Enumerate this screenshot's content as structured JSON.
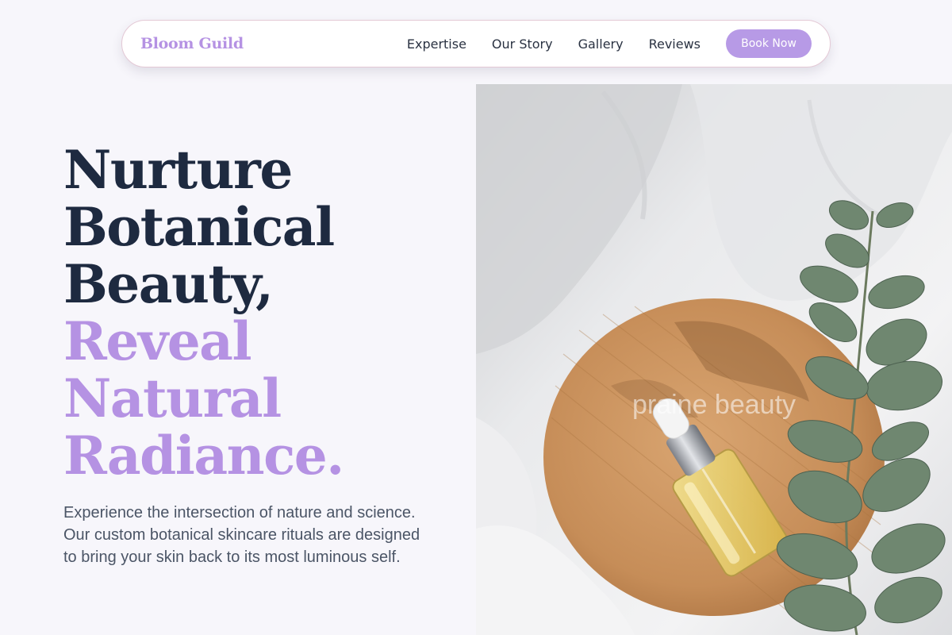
{
  "nav": {
    "brand": "Bloom Guild",
    "links": [
      "Expertise",
      "Our Story",
      "Gallery",
      "Reviews"
    ],
    "cta": "Book Now"
  },
  "hero": {
    "headline_dark": [
      "Nurture",
      "Botanical",
      "Beauty,"
    ],
    "headline_accent": [
      "Reveal",
      "Natural",
      "Radiance."
    ],
    "subtext": "Experience the intersection of nature and science. Our custom botanical skincare rituals are designed to bring your skin back to its most luminous self."
  },
  "photo": {
    "watermark": "praine beauty",
    "subject": "serum dropper bottle on wooden board with eucalyptus on white linen"
  },
  "colors": {
    "accent": "#b592e3",
    "heading": "#1e2a40",
    "body_text": "#4b5566",
    "background": "#f7f6fb",
    "button": "#b79ae6"
  }
}
